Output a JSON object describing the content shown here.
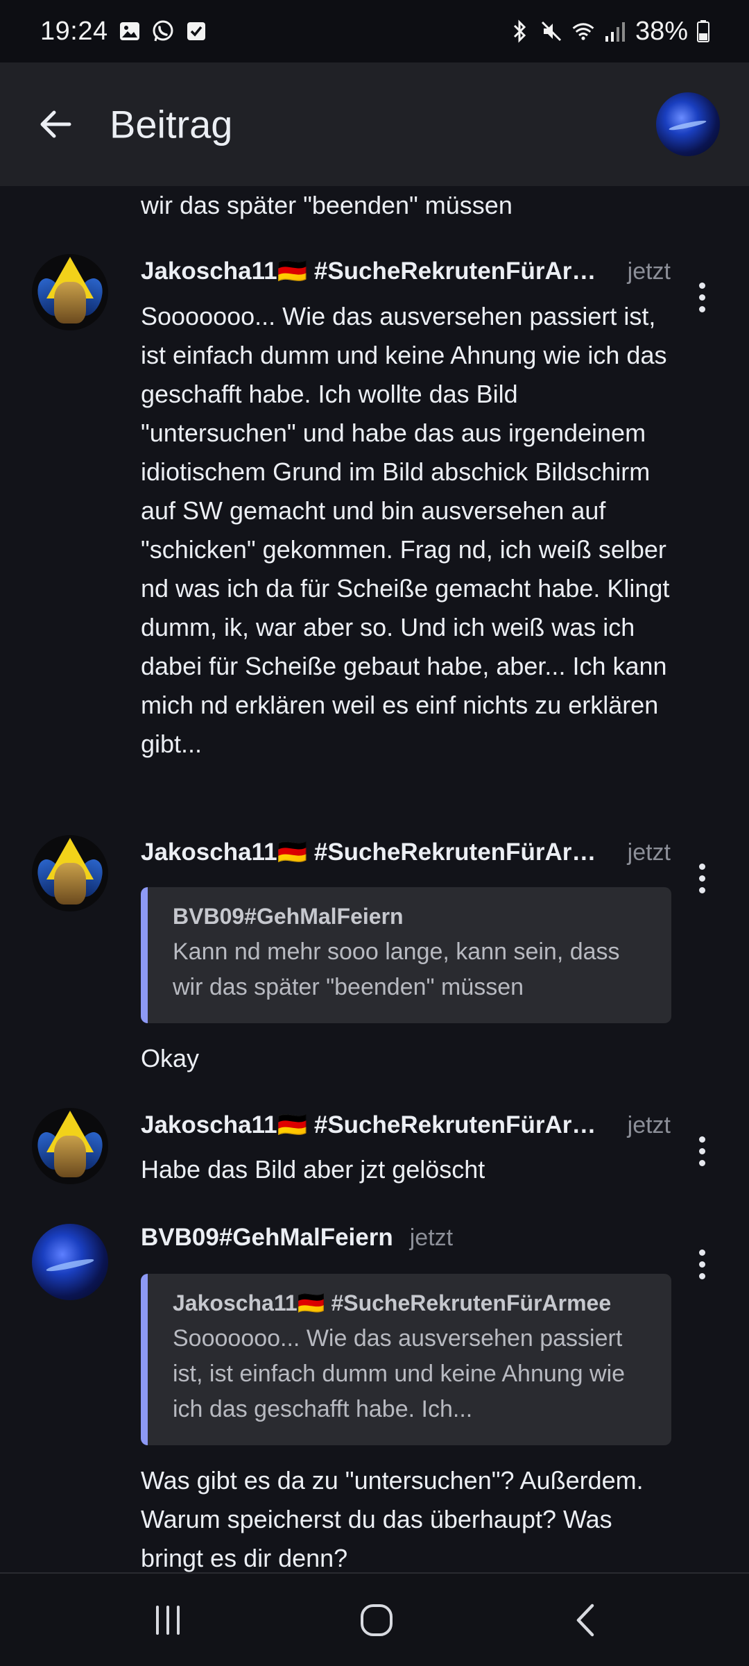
{
  "status_bar": {
    "time": "19:24",
    "battery": "38%",
    "left_icons": [
      "gallery-icon",
      "whatsapp-icon",
      "checkbox-icon"
    ],
    "right_icons": [
      "bluetooth-icon",
      "mute-icon",
      "wifi-icon",
      "signal-icon",
      "battery-icon"
    ]
  },
  "app_bar": {
    "title": "Beitrag"
  },
  "feed": {
    "cutoff_text": "wir das später \"beenden\" müssen",
    "messages": [
      {
        "author": "Jakoscha11🇩🇪 #SucheRekrutenFürArm...",
        "time": "jetzt",
        "body": "Sooooooo... Wie das ausversehen passiert ist, ist einfach dumm und keine Ahnung wie ich das geschafft habe. Ich wollte das Bild \"untersuchen\" und habe das aus irgendeinem idiotischem Grund im Bild abschick Bildschirm auf SW gemacht und bin ausversehen auf \"schicken\" gekommen. Frag nd, ich weiß selber nd was ich da für Scheiße gemacht habe. Klingt dumm, ik, war aber so. Und ich weiß was ich dabei für Scheiße gebaut habe, aber... Ich kann mich nd erklären weil es einf nichts zu erklären gibt..."
      },
      {
        "author": "Jakoscha11🇩🇪 #SucheRekrutenFürArm...",
        "time": "jetzt",
        "quote_author": "BVB09#GehMalFeiern",
        "quote_text": "Kann nd mehr sooo lange, kann sein, dass wir das später \"beenden\" müssen",
        "body": "Okay"
      },
      {
        "author": "Jakoscha11🇩🇪 #SucheRekrutenFürArm...",
        "time": "jetzt",
        "body": "Habe das Bild aber jzt gelöscht"
      },
      {
        "author": "BVB09#GehMalFeiern",
        "time": "jetzt",
        "quote_author": "Jakoscha11🇩🇪 #SucheRekrutenFürArmee",
        "quote_text": "Sooooooo... Wie das ausversehen passiert ist, ist einfach dumm und keine Ahnung wie ich das geschafft habe. Ich...",
        "body": "Was gibt es da zu \"untersuchen\"? Außerdem. Warum speicherst du das überhaupt? Was bringt es dir denn?"
      }
    ]
  },
  "nav_bar": {
    "icons": [
      "recents-icon",
      "home-icon",
      "back-nav-icon"
    ]
  }
}
